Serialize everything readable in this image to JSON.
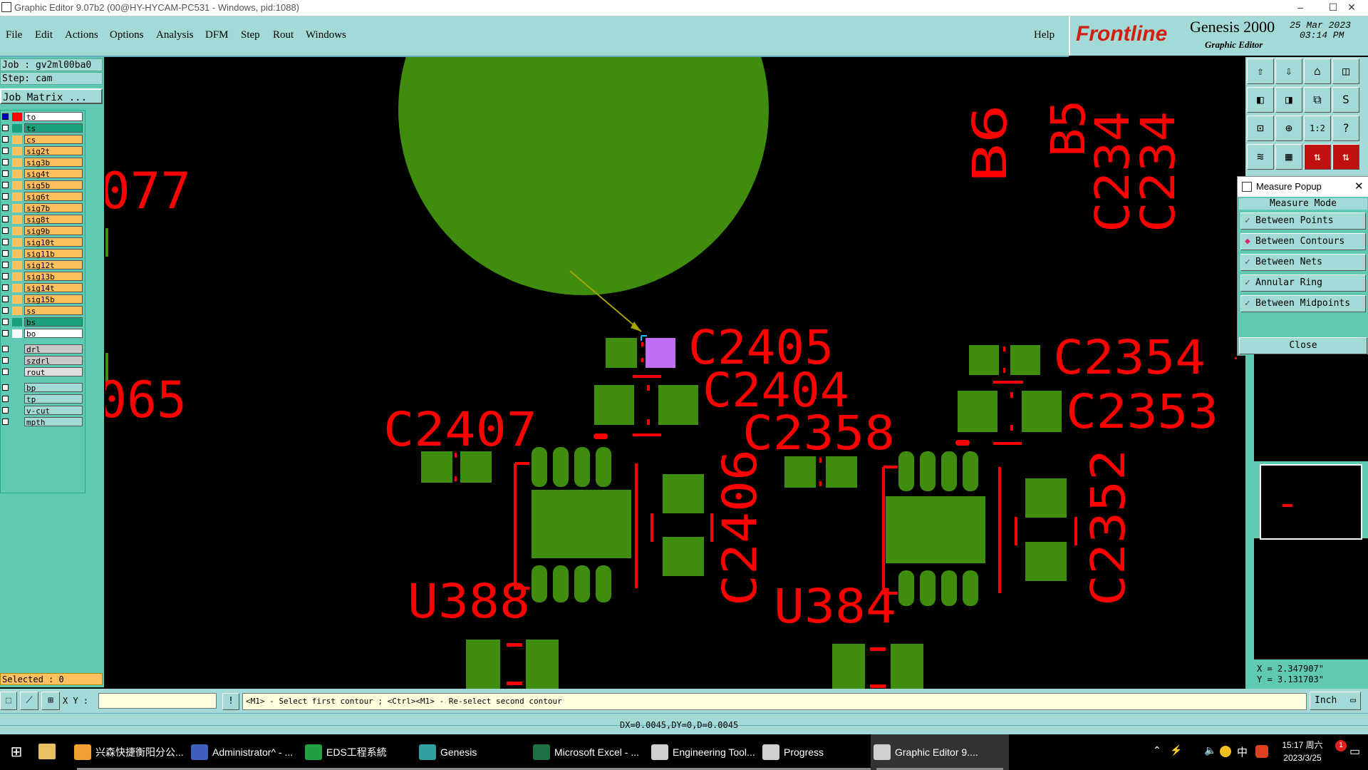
{
  "window": {
    "title": "Graphic Editor 9.07b2 (00@HY-HYCAM-PC531 - Windows, pid:1088)",
    "controls": {
      "minimize": "–",
      "maximize": "☐",
      "close": "✕"
    }
  },
  "menu": {
    "items": [
      "File",
      "Edit",
      "Actions",
      "Options",
      "Analysis",
      "DFM",
      "Step",
      "Rout",
      "Windows"
    ],
    "help": "Help"
  },
  "brand": {
    "logo": "Frontline",
    "product": "Genesis 2000",
    "subtitle": "Graphic Editor",
    "date": "25 Mar 2023",
    "time": "03:14 PM"
  },
  "left": {
    "job": "Job : gv2ml00ba0",
    "step": "Step: cam",
    "job_matrix": "Job Matrix ...",
    "selected": "Selected : 0",
    "layers_a": [
      {
        "name": "to",
        "color": "#ff0000",
        "bg": "#ffffff"
      },
      {
        "name": "ts",
        "color": "#1aa07a",
        "bg": "#1aa07a"
      },
      {
        "name": "cs",
        "color": "#ffc060",
        "bg": "#ffc060"
      },
      {
        "name": "sig2t",
        "color": "#ffc060",
        "bg": "#ffc060"
      },
      {
        "name": "sig3b",
        "color": "#ffc060",
        "bg": "#ffc060"
      },
      {
        "name": "sig4t",
        "color": "#ffc060",
        "bg": "#ffc060"
      },
      {
        "name": "sig5b",
        "color": "#ffc060",
        "bg": "#ffc060"
      },
      {
        "name": "sig6t",
        "color": "#ffc060",
        "bg": "#ffc060"
      },
      {
        "name": "sig7b",
        "color": "#ffc060",
        "bg": "#ffc060"
      },
      {
        "name": "sig8t",
        "color": "#ffc060",
        "bg": "#ffc060"
      },
      {
        "name": "sig9b",
        "color": "#ffc060",
        "bg": "#ffc060"
      },
      {
        "name": "sig10t",
        "color": "#ffc060",
        "bg": "#ffc060"
      },
      {
        "name": "sig11b",
        "color": "#ffc060",
        "bg": "#ffc060"
      },
      {
        "name": "sig12t",
        "color": "#ffc060",
        "bg": "#ffc060"
      },
      {
        "name": "sig13b",
        "color": "#ffc060",
        "bg": "#ffc060"
      },
      {
        "name": "sig14t",
        "color": "#ffc060",
        "bg": "#ffc060"
      },
      {
        "name": "sig15b",
        "color": "#ffc060",
        "bg": "#ffc060"
      },
      {
        "name": "ss",
        "color": "#ffc060",
        "bg": "#ffc060"
      },
      {
        "name": "bs",
        "color": "#1aa07a",
        "bg": "#1aa07a"
      },
      {
        "name": "bo",
        "color": "#ffffff",
        "bg": "#ffffff"
      }
    ],
    "layers_b": [
      {
        "name": "drl",
        "bg": "#c8c8c8"
      },
      {
        "name": "szdrl",
        "bg": "#c8c8c8"
      },
      {
        "name": "rout",
        "bg": "#e0e0e0"
      }
    ],
    "layers_c": [
      {
        "name": "bp",
        "bg": "#a3dad8"
      },
      {
        "name": "tp",
        "bg": "#a3dad8"
      },
      {
        "name": "v-cut",
        "bg": "#a3dad8"
      },
      {
        "name": "mpth",
        "bg": "#a3dad8"
      }
    ]
  },
  "canvas": {
    "labels": [
      "077",
      "065",
      "B6",
      "B5",
      "C234",
      "C234",
      "C2405",
      "C2404",
      "C2354",
      "C2353",
      "C2407",
      "C2358",
      "C2406",
      "C2352",
      "U388",
      "U384"
    ]
  },
  "measure": {
    "title": "Measure Popup",
    "mode_header": "Measure Mode",
    "modes": [
      {
        "label": "Between Points",
        "selected": false
      },
      {
        "label": "Between Contours",
        "selected": true
      },
      {
        "label": "Between Nets",
        "selected": false
      },
      {
        "label": "Annular Ring",
        "selected": false
      },
      {
        "label": "Between Midpoints",
        "selected": false
      }
    ],
    "close": "Close"
  },
  "coords": {
    "x": "X = 2.347907\"",
    "y": "Y = 3.131703\""
  },
  "cmd": {
    "xy_label": "X Y :",
    "xy_value": "",
    "prompt": "<M1> - Select first contour ; <Ctrl><M1> - Re-select second contour",
    "units": "Inch"
  },
  "status": {
    "text": "DX=0.0045,DY=0,D=0.0045"
  },
  "taskbar": {
    "apps": [
      {
        "label": "兴森快捷衡阳分公...",
        "color": "#f0a030"
      },
      {
        "label": "Administrator^ - ...",
        "color": "#4060c0"
      },
      {
        "label": "EDS工程系統",
        "color": "#20a040"
      },
      {
        "label": "Genesis",
        "color": "#30a0a0"
      },
      {
        "label": "Microsoft Excel - ...",
        "color": "#1d7044"
      },
      {
        "label": "Engineering Tool...",
        "color": "#d0d0d0"
      },
      {
        "label": "Progress",
        "color": "#d0d0d0"
      },
      {
        "label": "Graphic Editor 9....",
        "color": "#d0d0d0"
      }
    ],
    "tray": {
      "ime": "中",
      "time": "15:17 周六",
      "date": "2023/3/25",
      "notification": "1"
    }
  }
}
